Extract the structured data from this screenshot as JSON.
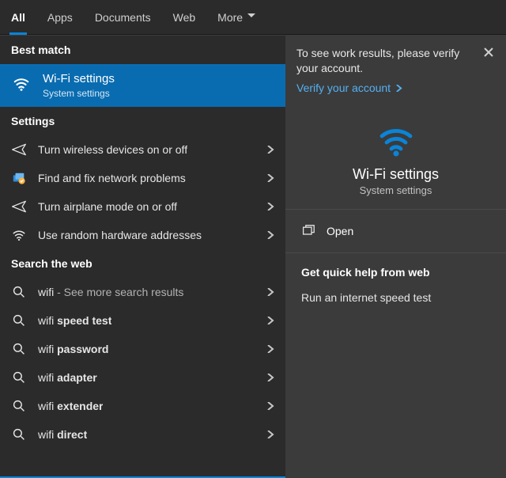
{
  "tabs": {
    "all": "All",
    "apps": "Apps",
    "documents": "Documents",
    "web": "Web",
    "more": "More"
  },
  "sections": {
    "best_match": "Best match",
    "settings": "Settings",
    "search_web": "Search the web"
  },
  "best_match": {
    "title": "Wi-Fi settings",
    "sub": "System settings"
  },
  "settings_items": [
    {
      "label": "Turn wireless devices on or off"
    },
    {
      "label": "Find and fix network problems"
    },
    {
      "label": "Turn airplane mode on or off"
    },
    {
      "label": "Use random hardware addresses"
    }
  ],
  "web_items": [
    {
      "prefix": "wifi",
      "suffix": " - See more search results",
      "suffix_muted": true
    },
    {
      "prefix": "wifi ",
      "bold": "speed test"
    },
    {
      "prefix": "wifi ",
      "bold": "password"
    },
    {
      "prefix": "wifi ",
      "bold": "adapter"
    },
    {
      "prefix": "wifi ",
      "bold": "extender"
    },
    {
      "prefix": "wifi ",
      "bold": "direct"
    }
  ],
  "banner": {
    "text": "To see work results, please verify your account.",
    "verify": "Verify your account"
  },
  "detail": {
    "title": "Wi-Fi settings",
    "sub": "System settings",
    "open": "Open",
    "help_head": "Get quick help from web",
    "help_items": [
      "Run an internet speed test"
    ]
  },
  "colors": {
    "accent": "#0a84d8"
  }
}
